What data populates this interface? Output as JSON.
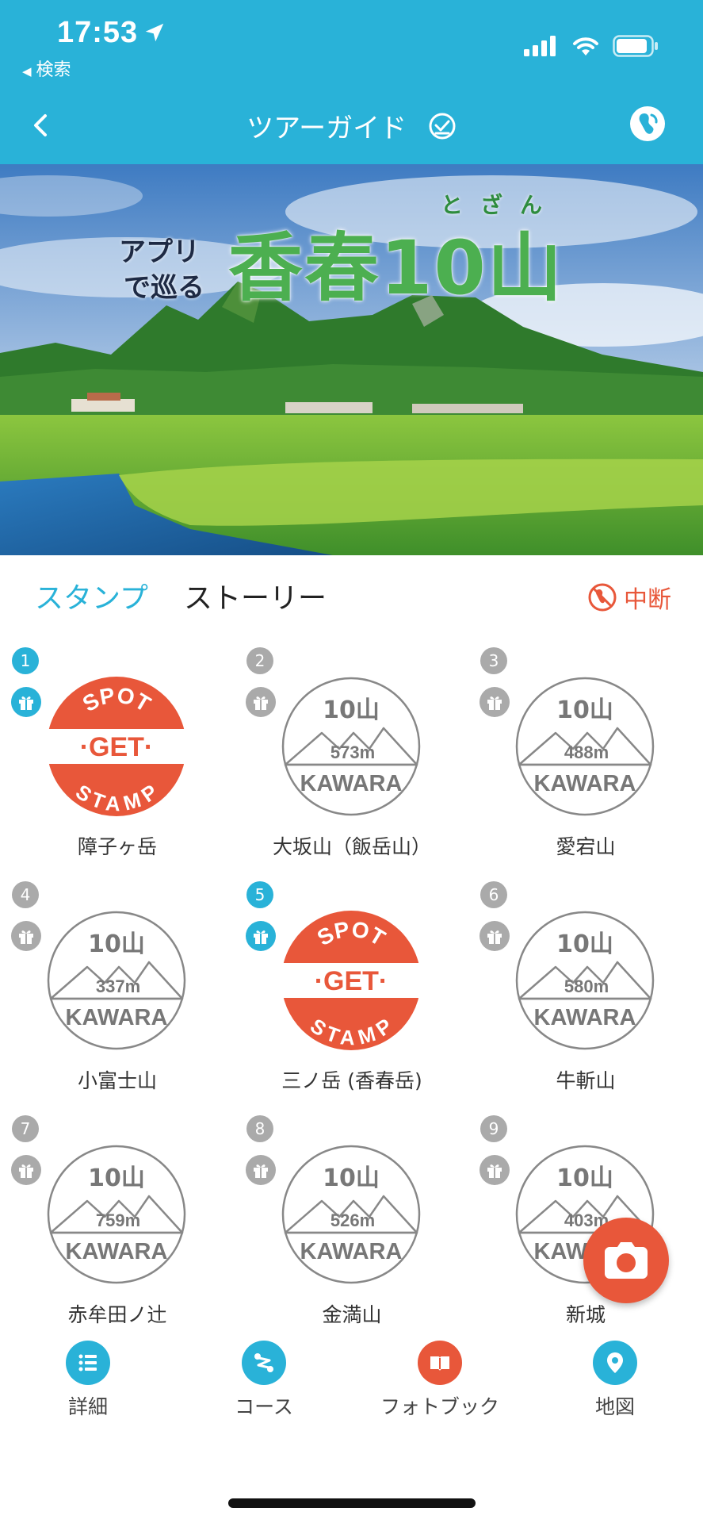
{
  "status_bar": {
    "time": "17:53",
    "back_app": "検索"
  },
  "nav": {
    "title": "ツアーガイド"
  },
  "banner": {
    "subtitle_line1": "アプリ",
    "subtitle_line2": "で巡る",
    "title": "香春10山",
    "ruby": "とざん"
  },
  "tabs": {
    "stamp": "スタンプ",
    "story": "ストーリー",
    "pause": "中断"
  },
  "stamps": [
    {
      "number": "1",
      "name": "障子ヶ岳",
      "status": "get"
    },
    {
      "number": "2",
      "name": "大坂山（飯岳山）",
      "status": "locked",
      "altitude": "573m"
    },
    {
      "number": "3",
      "name": "愛宕山",
      "status": "locked",
      "altitude": "488m"
    },
    {
      "number": "4",
      "name": "小富士山",
      "status": "locked",
      "altitude": "337m"
    },
    {
      "number": "5",
      "name": "三ノ岳 (香春岳)",
      "status": "get"
    },
    {
      "number": "6",
      "name": "牛斬山",
      "status": "locked",
      "altitude": "580m"
    },
    {
      "number": "7",
      "name": "赤牟田ノ辻",
      "status": "locked",
      "altitude": "759m"
    },
    {
      "number": "8",
      "name": "金満山",
      "status": "locked",
      "altitude": "526m"
    },
    {
      "number": "9",
      "name": "新城",
      "status": "locked",
      "altitude": "403m"
    }
  ],
  "stamp_text": {
    "brand": "10山",
    "area": "KAWARA",
    "get_top": "SPOT",
    "get_mid": "GET",
    "get_bottom": "STAMP"
  },
  "bottom_nav": [
    {
      "label": "詳細",
      "icon": "list-icon"
    },
    {
      "label": "コース",
      "icon": "route-icon"
    },
    {
      "label": "フォトブック",
      "icon": "book-icon"
    },
    {
      "label": "地図",
      "icon": "map-pin-icon"
    }
  ],
  "colors": {
    "primary": "#29b2d8",
    "accent": "#e8573a",
    "locked": "#aaaaaa"
  }
}
